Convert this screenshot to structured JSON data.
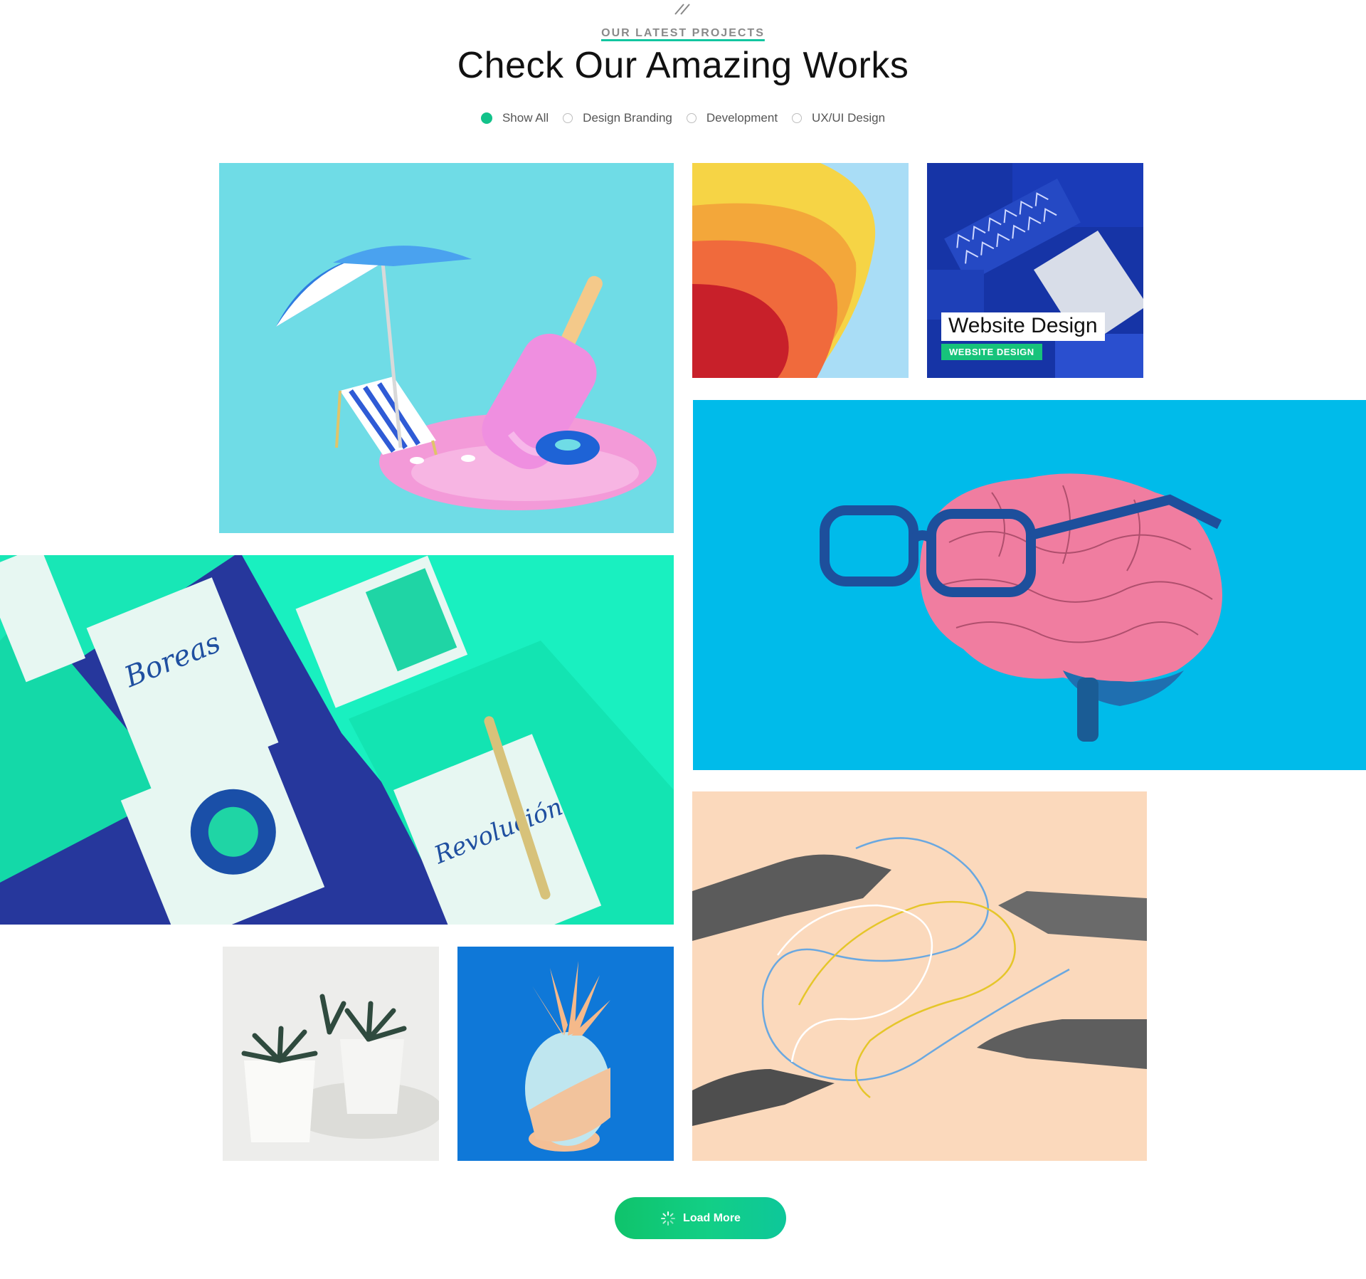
{
  "header": {
    "eyebrow": "OUR LATEST PROJECTS",
    "title": "Check Our Amazing Works",
    "decoration_icon": "double-slash-icon"
  },
  "filters": [
    {
      "label": "Show All",
      "active": true
    },
    {
      "label": "Design Branding",
      "active": false
    },
    {
      "label": "Development",
      "active": false
    },
    {
      "label": "UX/UI Design",
      "active": false
    }
  ],
  "portfolio": {
    "items": [
      {
        "id": "beach",
        "image": "beach-umbrella-popsicle"
      },
      {
        "id": "paper",
        "image": "curled-paper"
      },
      {
        "id": "website",
        "image": "stationery-mockup",
        "title": "Website Design",
        "tag": "WEBSITE DESIGN"
      },
      {
        "id": "brain",
        "image": "brain-with-glasses"
      },
      {
        "id": "calendar",
        "image": "calendar-mockups"
      },
      {
        "id": "plants",
        "image": "potted-succulents"
      },
      {
        "id": "pineapple",
        "image": "pastel-pineapple"
      },
      {
        "id": "hands",
        "image": "reaching-hands"
      }
    ]
  },
  "load_more": {
    "label": "Load More",
    "icon": "spinner-icon"
  },
  "colors": {
    "accent": "#12c28a",
    "tag_green": "#17c37b",
    "beach_bg": "#6fdce6",
    "brain_bg": "#00bbea",
    "hands_bg": "#fbd9bc",
    "calendar_navy": "#26379c",
    "calendar_mint": "#19f0c0"
  }
}
